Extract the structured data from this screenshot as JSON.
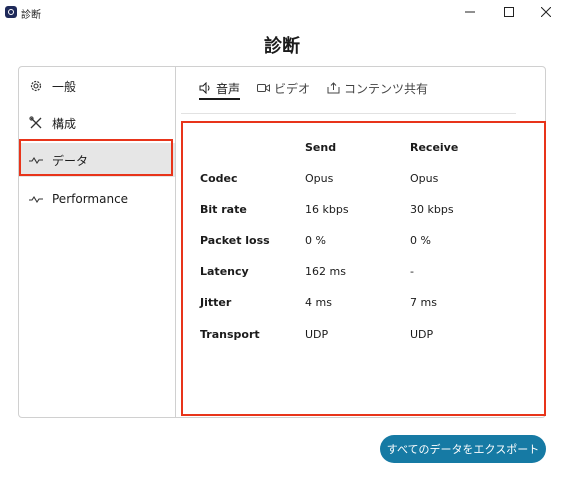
{
  "window": {
    "title": "診断",
    "minimize_icon": "minimize-icon",
    "maximize_icon": "maximize-icon",
    "close_icon": "close-icon"
  },
  "page": {
    "heading": "診断"
  },
  "sidebar": {
    "items": [
      {
        "label": "一般",
        "icon": "gear-icon"
      },
      {
        "label": "構成",
        "icon": "tools-icon"
      },
      {
        "label": "データ",
        "icon": "pulse-icon",
        "selected": true
      },
      {
        "label": "Performance",
        "icon": "pulse-icon"
      }
    ]
  },
  "tabs": [
    {
      "label": "音声",
      "icon": "speaker-icon",
      "selected": true
    },
    {
      "label": "ビデオ",
      "icon": "video-icon"
    },
    {
      "label": "コンテンツ共有",
      "icon": "share-icon"
    }
  ],
  "stats": {
    "headers": {
      "send": "Send",
      "receive": "Receive"
    },
    "rows": [
      {
        "label": "Codec",
        "send": "Opus",
        "receive": "Opus"
      },
      {
        "label": "Bit rate",
        "send": "16 kbps",
        "receive": "30 kbps"
      },
      {
        "label": "Packet loss",
        "send": "0 %",
        "receive": "0 %"
      },
      {
        "label": "Latency",
        "send": "162 ms",
        "receive": "-"
      },
      {
        "label": "Jitter",
        "send": "4 ms",
        "receive": "7 ms"
      },
      {
        "label": "Transport",
        "send": "UDP",
        "receive": "UDP"
      }
    ]
  },
  "actions": {
    "export_label": "すべてのデータをエクスポート"
  },
  "colors": {
    "accent": "#167aa4",
    "highlight": "#e8341a"
  }
}
